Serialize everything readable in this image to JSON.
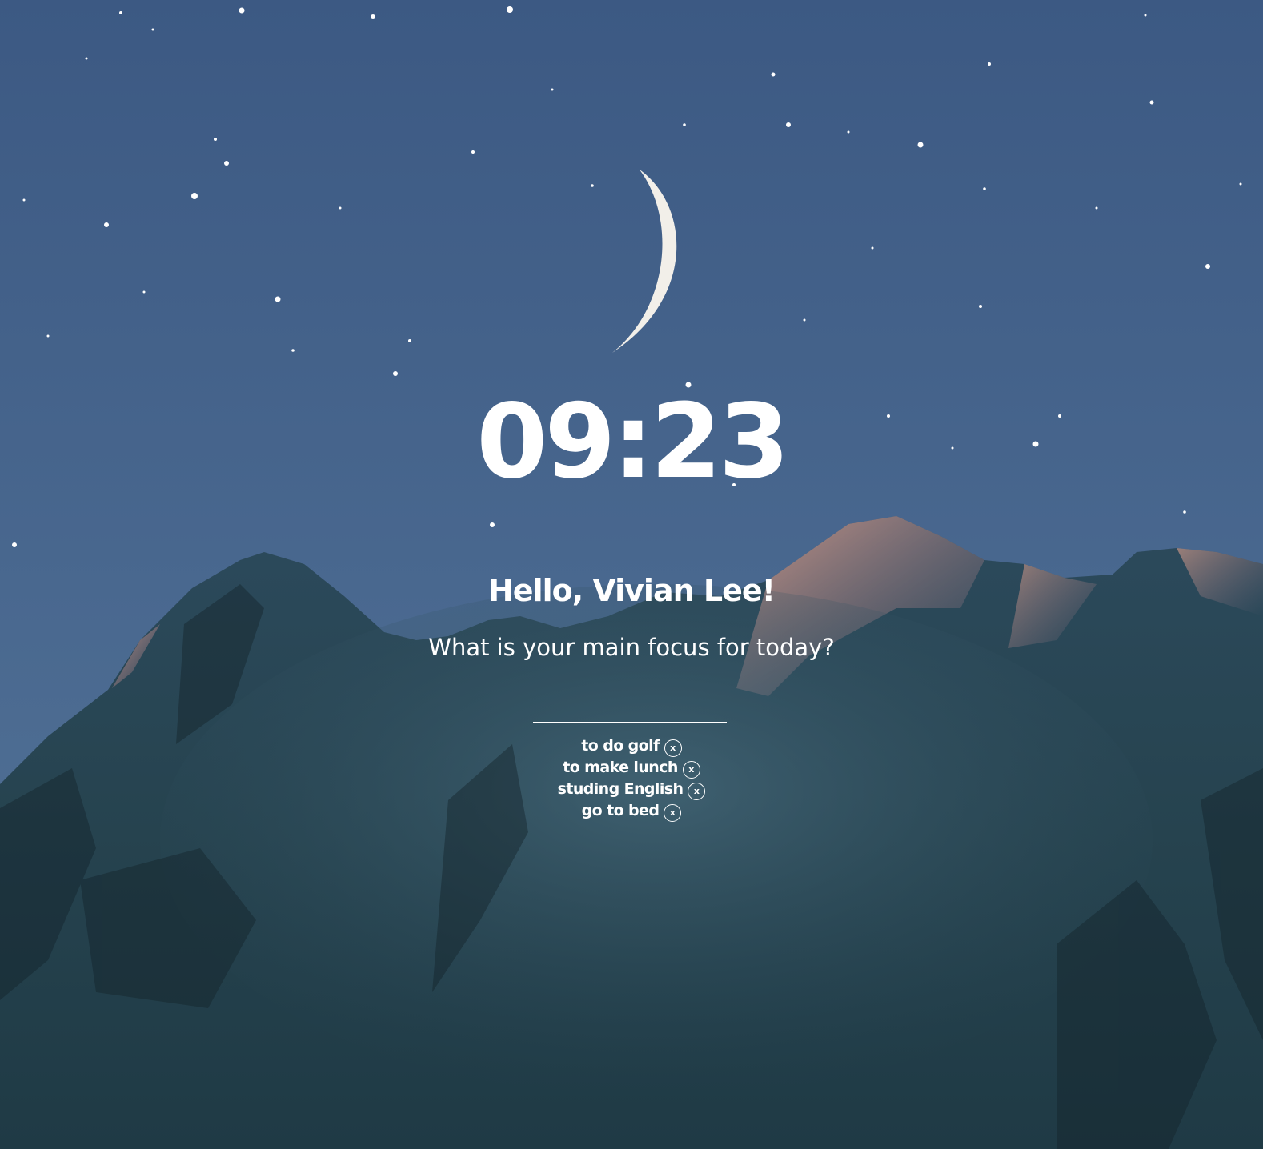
{
  "clock": {
    "time": "09:23"
  },
  "greeting": {
    "text": "Hello, Vivian Lee!"
  },
  "focus": {
    "question": "What is your main focus for today?",
    "input_value": ""
  },
  "todos": [
    {
      "text": "to do golf",
      "delete_icon": "x"
    },
    {
      "text": "to make lunch",
      "delete_icon": "x"
    },
    {
      "text": "studing English",
      "delete_icon": "x"
    },
    {
      "text": "go to bed",
      "delete_icon": "x"
    }
  ],
  "colors": {
    "sky_top": "#3f5d86",
    "sky_bottom": "#4f7095",
    "mountain": "#203b48",
    "alpenglow": "#c6907f",
    "text": "#ffffff"
  }
}
